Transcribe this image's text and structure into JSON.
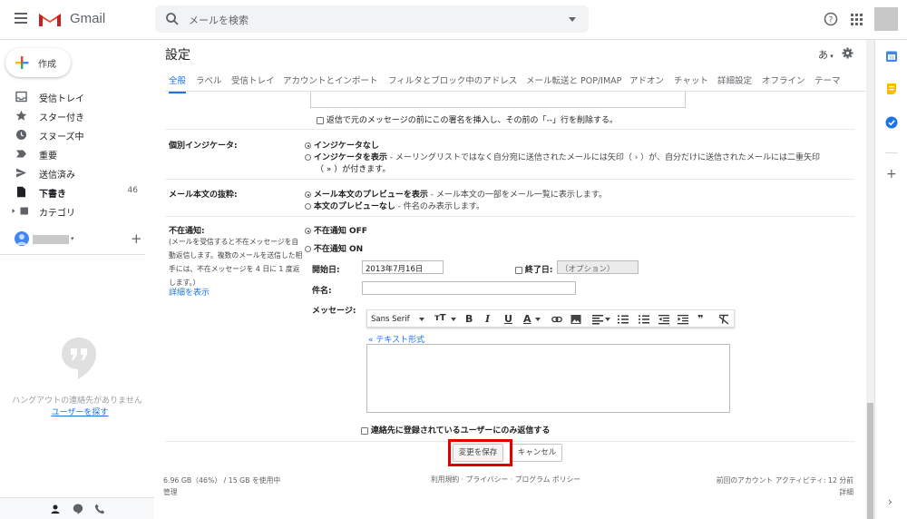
{
  "app": {
    "name": "Gmail"
  },
  "search": {
    "placeholder": "メールを検索"
  },
  "compose": {
    "label": "作成"
  },
  "nav": [
    {
      "label": "受信トレイ",
      "count": "",
      "icon": "inbox-icon"
    },
    {
      "label": "スター付き",
      "count": "",
      "icon": "star-icon"
    },
    {
      "label": "スヌーズ中",
      "count": "",
      "icon": "clock-icon"
    },
    {
      "label": "重要",
      "count": "",
      "icon": "label-important-icon"
    },
    {
      "label": "送信済み",
      "count": "",
      "icon": "send-icon"
    },
    {
      "label": "下書き",
      "count": "46",
      "icon": "draft-icon"
    },
    {
      "label": "カテゴリ",
      "count": "",
      "icon": "label-icon"
    }
  ],
  "hangouts": {
    "empty_text": "ハングアウトの連絡先がありません",
    "find_link": "ユーザーを探す",
    "add": "+"
  },
  "settings": {
    "title": "設定",
    "lang": "あ",
    "tabs": [
      "全般",
      "ラベル",
      "受信トレイ",
      "アカウントとインポート",
      "フィルタとブロック中のアドレス",
      "メール転送と POP/IMAP",
      "アドオン",
      "チャット",
      "詳細設定",
      "オフライン",
      "テーマ"
    ],
    "signature_option": "返信で元のメッセージの前にこの署名を挿入し、その前の「--」行を削除する。",
    "indicator": {
      "label": "個別インジケータ:",
      "opt1": "インジケータなし",
      "opt2_bold": "インジケータを表示",
      "opt2_desc": " - メーリングリストではなく自分宛に送信されたメールには矢印（ › ）が、自分だけに送信されたメールには二重矢印",
      "opt2_desc2": "（ » ）が付きます。"
    },
    "snippet": {
      "label": "メール本文の抜粋:",
      "opt1_bold": "メール本文のプレビューを表示",
      "opt1_desc": " - メール本文の一部をメール一覧に表示します。",
      "opt2_bold": "本文のプレビューなし",
      "opt2_desc": " - 件名のみ表示します。"
    },
    "vacation": {
      "label": "不在通知:",
      "desc": "(メールを受信すると不在メッセージを自動返信します。複数のメールを送信した相手には、不在メッセージを 4 日に 1 度返します。）",
      "detail_link": "詳細を表示",
      "off": "不在通知 OFF",
      "on": "不在通知 ON",
      "start_label": "開始日:",
      "start_value": "2013年7月16日",
      "end_label": "終了日:",
      "end_placeholder": "（オプション）",
      "subject_label": "件名:",
      "message_label": "メッセージ:",
      "font": "Sans Serif",
      "plain_text_link": "« テキスト形式",
      "contacts_only": "連絡先に登録されているユーザーにのみ返信する"
    },
    "save_button": "変更を保存",
    "cancel_button": "キャンセル"
  },
  "footer": {
    "storage": "6.96 GB（46%） / 15 GB を使用中",
    "manage": "管理",
    "links": "利用規約 · プライバシー · プログラム ポリシー",
    "last_activity": "前回のアカウント アクティビティ: 12 分前",
    "details": "詳細"
  },
  "colors": {
    "accent": "#1a73e8",
    "highlight": "#e00000"
  }
}
